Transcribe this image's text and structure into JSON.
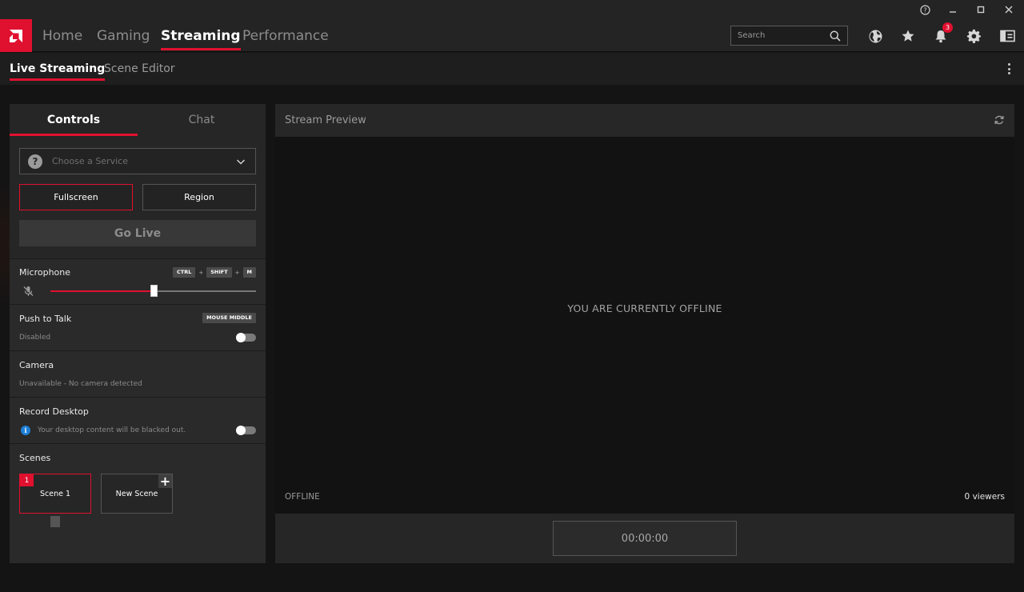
{
  "nav": {
    "items": [
      {
        "label": "Home",
        "active": false
      },
      {
        "label": "Gaming",
        "active": false
      },
      {
        "label": "Streaming",
        "active": true
      },
      {
        "label": "Performance",
        "active": false
      }
    ],
    "search_placeholder": "Search",
    "notification_count": "3",
    "icons": [
      "globe-icon",
      "star-icon",
      "bell-icon",
      "gear-icon",
      "sidebar-icon"
    ]
  },
  "subnav": {
    "tabs": [
      {
        "label": "Live Streaming",
        "active": true
      },
      {
        "label": "Scene Editor",
        "active": false
      }
    ]
  },
  "controls": {
    "tabs": [
      {
        "label": "Controls",
        "active": true
      },
      {
        "label": "Chat",
        "active": false
      }
    ],
    "service_placeholder": "Choose a Service",
    "mode_buttons": [
      {
        "label": "Fullscreen",
        "selected": true
      },
      {
        "label": "Region",
        "selected": false
      }
    ],
    "go_live_label": "Go Live",
    "microphone": {
      "title": "Microphone",
      "hotkeys": [
        "CTRL",
        "SHIFT",
        "M"
      ],
      "hotkey_separator": "+",
      "volume_fraction": 0.5
    },
    "push_to_talk": {
      "title": "Push to Talk",
      "hotkey": "MOUSE MIDDLE",
      "status": "Disabled",
      "enabled": false
    },
    "camera": {
      "title": "Camera",
      "status": "Unavailable - No camera detected"
    },
    "record_desktop": {
      "title": "Record Desktop",
      "info": "Your desktop content will be blacked out.",
      "enabled": false
    },
    "scenes": {
      "title": "Scenes",
      "items": [
        {
          "number": "1",
          "label": "Scene 1",
          "selected": true
        },
        {
          "label": "New Scene",
          "selected": false
        }
      ]
    }
  },
  "preview": {
    "title": "Stream Preview",
    "message": "YOU ARE CURRENTLY OFFLINE",
    "status": "OFFLINE",
    "viewers": "0 viewers",
    "timer": "00:00:00"
  },
  "colors": {
    "accent": "#e0102f",
    "background": "#161616",
    "panel": "#262626"
  }
}
